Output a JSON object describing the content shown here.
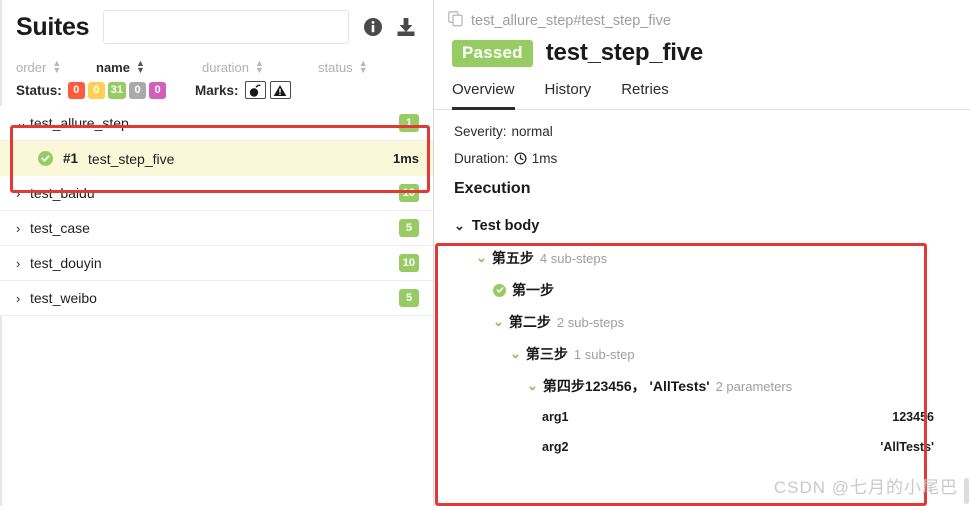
{
  "left": {
    "title": "Suites",
    "search": {
      "value": "",
      "placeholder": ""
    },
    "icons": {
      "info": "info-icon",
      "download": "download-icon"
    },
    "sort_columns": [
      {
        "label": "order",
        "active": false
      },
      {
        "label": "name",
        "active": true
      },
      {
        "label": "duration",
        "active": false
      },
      {
        "label": "status",
        "active": false
      }
    ],
    "status_label": "Status:",
    "status_badges": [
      {
        "value": "0",
        "color": "#fd5a3e"
      },
      {
        "value": "0",
        "color": "#ffd050"
      },
      {
        "value": "31",
        "color": "#97cc64"
      },
      {
        "value": "0",
        "color": "#aaaaaa"
      },
      {
        "value": "0",
        "color": "#d35ebe"
      }
    ],
    "marks_label": "Marks:",
    "marks": [
      {
        "icon": "bomb-icon"
      },
      {
        "icon": "warning-triangle-icon"
      }
    ],
    "tree": [
      {
        "label": "test_allure_step",
        "count": "1",
        "expanded": true,
        "selected": false
      },
      {
        "label": "test_step_five",
        "num": "#1",
        "duration": "1ms",
        "child": true,
        "selected": true
      },
      {
        "label": "test_baidu",
        "count": "10",
        "expanded": false
      },
      {
        "label": "test_case",
        "count": "5",
        "expanded": false
      },
      {
        "label": "test_douyin",
        "count": "10",
        "expanded": false
      },
      {
        "label": "test_weibo",
        "count": "5",
        "expanded": false
      }
    ]
  },
  "right": {
    "breadcrumb": "test_allure_step#test_step_five",
    "breadcrumb_icon": "copy-icon",
    "status_badge": "Passed",
    "title": "test_step_five",
    "tabs": [
      {
        "label": "Overview",
        "active": true
      },
      {
        "label": "History",
        "active": false
      },
      {
        "label": "Retries",
        "active": false
      }
    ],
    "severity_label": "Severity:",
    "severity_value": "normal",
    "duration_label": "Duration:",
    "duration_value": "1ms",
    "duration_icon": "clock-icon",
    "execution_title": "Execution",
    "test_body": {
      "label": "Test body",
      "steps": [
        {
          "label": "第五步",
          "note": "4 sub-steps",
          "indent": 1,
          "marker": "chevron"
        },
        {
          "label": "第一步",
          "note": "",
          "indent": 2,
          "marker": "check"
        },
        {
          "label": "第二步",
          "note": "2 sub-steps",
          "indent": 2,
          "marker": "chevron"
        },
        {
          "label": "第三步",
          "note": "1 sub-step",
          "indent": 3,
          "marker": "chevron"
        },
        {
          "label": "第四步123456， 'AllTests'",
          "note": "2 parameters",
          "indent": 4,
          "marker": "chevron"
        }
      ],
      "parameters": [
        {
          "name": "arg1",
          "value": "123456"
        },
        {
          "name": "arg2",
          "value": "'AllTests'"
        }
      ]
    }
  },
  "watermark": "CSDN @七月的小尾巴",
  "colors": {
    "green": "#97cc64",
    "red_highlight": "#e03a34",
    "selected_row": "#fbf7d9"
  }
}
